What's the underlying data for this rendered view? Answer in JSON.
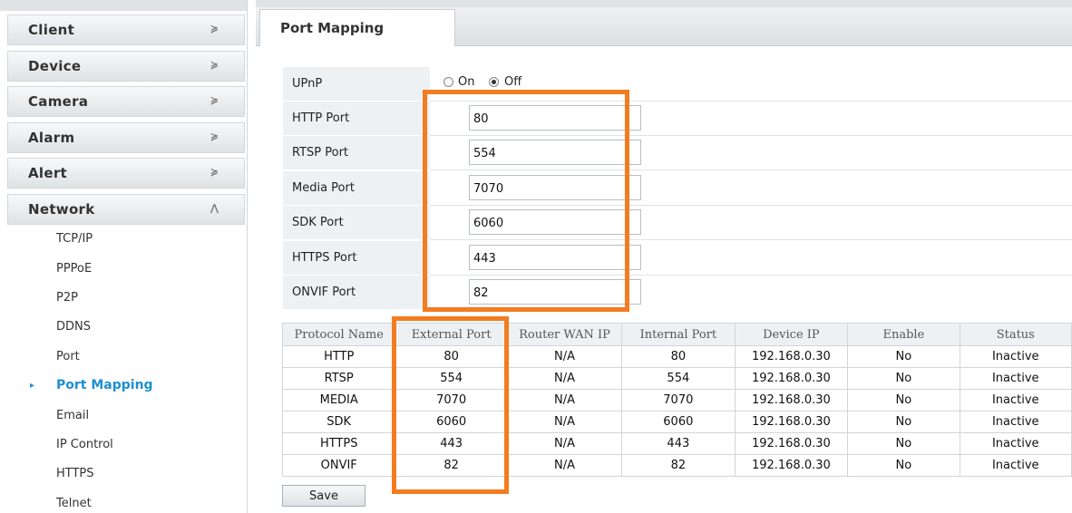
{
  "sidebar": {
    "sections": [
      {
        "label": "Client",
        "chevron": "≽"
      },
      {
        "label": "Device",
        "chevron": "≽"
      },
      {
        "label": "Camera",
        "chevron": "≽"
      },
      {
        "label": "Alarm",
        "chevron": "≽"
      },
      {
        "label": "Alert",
        "chevron": "≽"
      },
      {
        "label": "Network",
        "chevron": "⋀"
      }
    ],
    "network_items": [
      "TCP/IP",
      "PPPoE",
      "P2P",
      "DDNS",
      "Port",
      "Port Mapping",
      "Email",
      "IP Control",
      "HTTPS",
      "Telnet"
    ],
    "active_item": "Port Mapping",
    "active_marker": "▸"
  },
  "main": {
    "tab_title": "Port Mapping",
    "upnp": {
      "label": "UPnP",
      "on_label": "On",
      "off_label": "Off",
      "selected": "Off"
    },
    "ports": [
      {
        "label": "HTTP Port",
        "value": "80"
      },
      {
        "label": "RTSP Port",
        "value": "554"
      },
      {
        "label": "Media Port",
        "value": "7070"
      },
      {
        "label": "SDK Port",
        "value": "6060"
      },
      {
        "label": "HTTPS Port",
        "value": "443"
      },
      {
        "label": "ONVIF Port",
        "value": "82"
      }
    ],
    "table": {
      "headers": [
        "Protocol Name",
        "External Port",
        "Router WAN IP",
        "Internal Port",
        "Device IP",
        "Enable",
        "Status"
      ],
      "rows": [
        [
          "HTTP",
          "80",
          "N/A",
          "80",
          "192.168.0.30",
          "No",
          "Inactive"
        ],
        [
          "RTSP",
          "554",
          "N/A",
          "554",
          "192.168.0.30",
          "No",
          "Inactive"
        ],
        [
          "MEDIA",
          "7070",
          "N/A",
          "7070",
          "192.168.0.30",
          "No",
          "Inactive"
        ],
        [
          "SDK",
          "6060",
          "N/A",
          "6060",
          "192.168.0.30",
          "No",
          "Inactive"
        ],
        [
          "HTTPS",
          "443",
          "N/A",
          "443",
          "192.168.0.30",
          "No",
          "Inactive"
        ],
        [
          "ONVIF",
          "82",
          "N/A",
          "82",
          "192.168.0.30",
          "No",
          "Inactive"
        ]
      ]
    },
    "save_label": "Save"
  },
  "colors": {
    "highlight": "#f47c20",
    "active_link": "#1d8fd1"
  }
}
